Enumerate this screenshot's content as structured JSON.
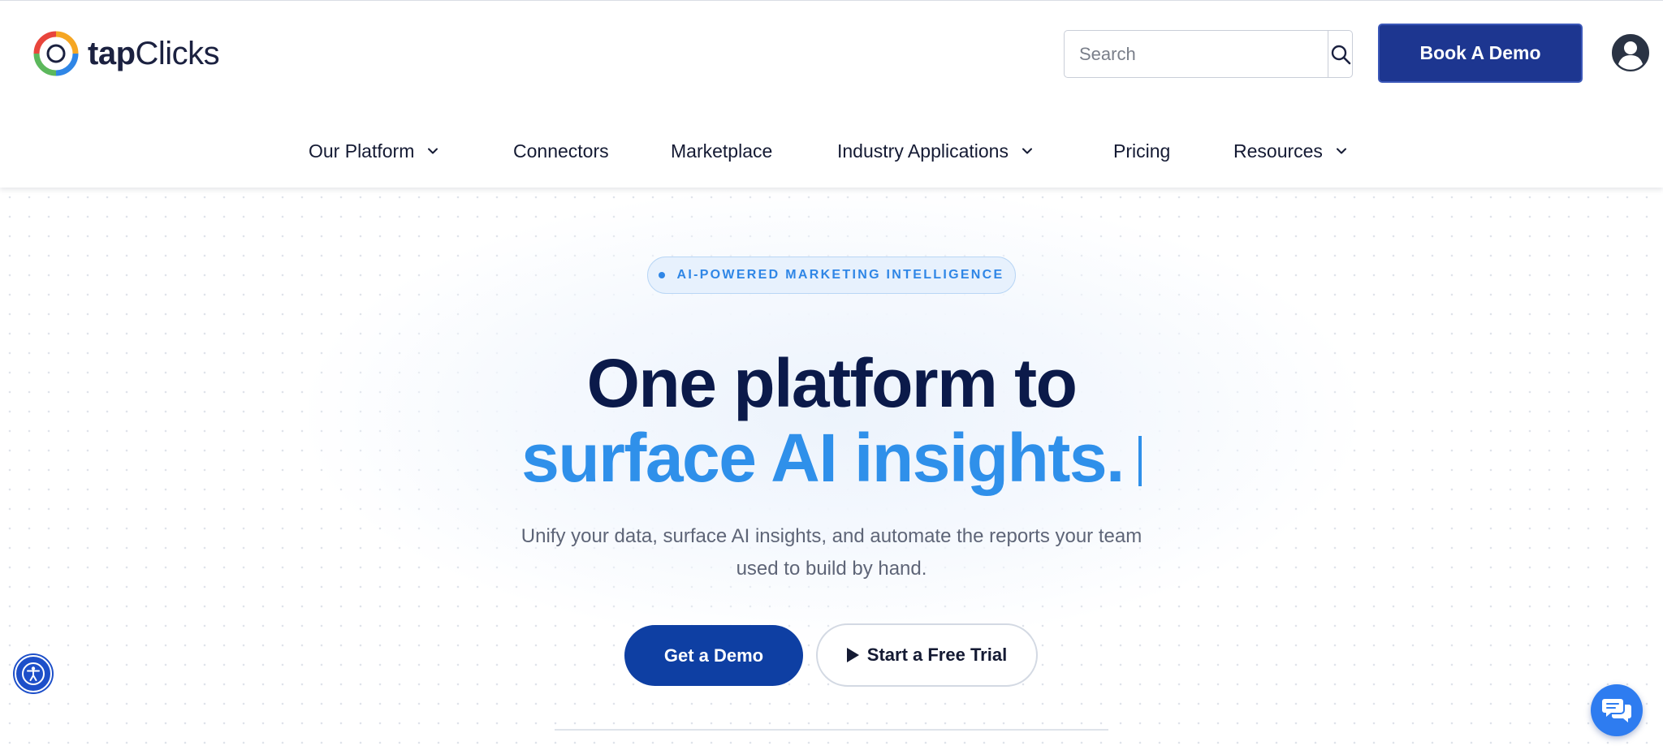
{
  "header": {
    "logo": {
      "text_bold": "tap",
      "text_regular": "Clicks",
      "icon": "tapclicks-ring-logo"
    },
    "search": {
      "placeholder": "Search",
      "icon": "search-icon"
    },
    "book_demo_label": "Book A Demo",
    "account_icon": "user-circle-icon"
  },
  "nav": {
    "items": [
      {
        "label": "Our Platform",
        "has_dropdown": true
      },
      {
        "label": "Connectors",
        "has_dropdown": false
      },
      {
        "label": "Marketplace",
        "has_dropdown": false
      },
      {
        "label": "Industry Applications",
        "has_dropdown": true
      },
      {
        "label": "Pricing",
        "has_dropdown": false
      },
      {
        "label": "Resources",
        "has_dropdown": true
      }
    ]
  },
  "hero": {
    "badge": "AI-POWERED MARKETING INTELLIGENCE",
    "headline_line1": "One platform to",
    "headline_line2": "surface AI insights.",
    "subtext": "Unify your data, surface AI insights, and automate the reports your team used to build by hand.",
    "primary_cta": "Get a Demo",
    "secondary_cta": "Start a Free Trial"
  },
  "floating": {
    "accessibility_icon": "accessibility-icon",
    "chat_icon": "chat-bubbles-icon"
  },
  "colors": {
    "brand_navy": "#1d3690",
    "cta_blue": "#0e3fa3",
    "accent_blue": "#2f90ea",
    "headline_dark": "#0b1a4a",
    "chat_blue": "#2e7cf0"
  }
}
